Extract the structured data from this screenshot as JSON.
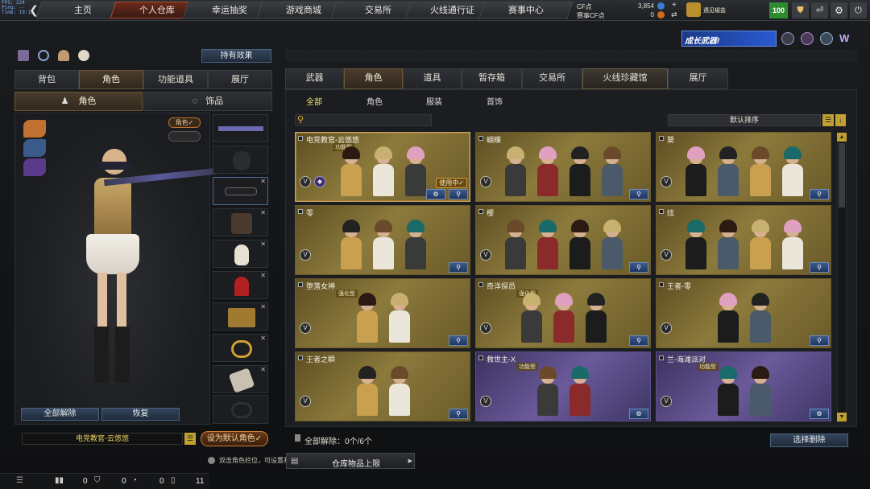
{
  "fps": [
    "FPS: 224",
    "Ping: --",
    "Time: 19:12"
  ],
  "nav": [
    "主页",
    "个人仓库",
    "幸运抽奖",
    "游戏商城",
    "交易所",
    "火线通行证",
    "赛事中心"
  ],
  "currency": {
    "cf_label": "CF点",
    "cf_value": "3,854",
    "match_label": "赛事CF点",
    "match_value": "0"
  },
  "user": {
    "name": "遇见椒盐",
    "level": "100"
  },
  "banner": "成长武器!",
  "left": {
    "effect_button": "持有效果",
    "tabs": [
      "背包",
      "角色",
      "功能道具",
      "展厅"
    ],
    "subtabs": [
      "角色",
      "饰品"
    ],
    "role_tag": "角色✓",
    "unequip_all": "全部解除",
    "restore": "恢复",
    "current_char": "电竞教官-云悠悠",
    "set_default": "设为默认角色✓"
  },
  "right": {
    "tabs": [
      "武器",
      "角色",
      "道具",
      "暂存箱",
      "交易所",
      "火线珍藏馆",
      "展厅"
    ],
    "subtabs": [
      "全部",
      "角色",
      "服装",
      "首饰"
    ],
    "sort": "默认排序",
    "unequip_count": "全部解除：0个/6个",
    "select_delete": "选择删除"
  },
  "cards": [
    {
      "name": "电竞教官-云悠悠",
      "tag": "功能型",
      "in_use": "使用中✓",
      "theme": "gold",
      "figures": 3
    },
    {
      "name": "蝴蝶",
      "tag": "",
      "in_use": "",
      "theme": "gold",
      "figures": 4
    },
    {
      "name": "葵",
      "tag": "",
      "in_use": "",
      "theme": "gold",
      "figures": 4
    },
    {
      "name": "零",
      "tag": "",
      "in_use": "",
      "theme": "gold",
      "figures": 3
    },
    {
      "name": "樱",
      "tag": "",
      "in_use": "",
      "theme": "gold",
      "figures": 4
    },
    {
      "name": "炫",
      "tag": "",
      "in_use": "",
      "theme": "gold",
      "figures": 4
    },
    {
      "name": "堕落女神",
      "tag": "强化型",
      "in_use": "",
      "theme": "gold",
      "figures": 2
    },
    {
      "name": "奇洋探员",
      "tag": "强化型",
      "in_use": "",
      "theme": "gold",
      "figures": 3
    },
    {
      "name": "王者-零",
      "tag": "",
      "in_use": "",
      "theme": "gold",
      "figures": 2
    },
    {
      "name": "王者之瞬",
      "tag": "",
      "in_use": "",
      "theme": "gold",
      "figures": 2
    },
    {
      "name": "救世主-X",
      "tag": "功能型",
      "in_use": "",
      "theme": "purple",
      "figures": 2
    },
    {
      "name": "兰-海滩派对",
      "tag": "功能型",
      "in_use": "",
      "theme": "purple",
      "figures": 2
    }
  ],
  "bottom": {
    "hint": "双击角色栏位，可设置基本...",
    "storage_limit": "仓库物品上限",
    "counts": [
      "0",
      "0",
      "0",
      "11"
    ]
  }
}
